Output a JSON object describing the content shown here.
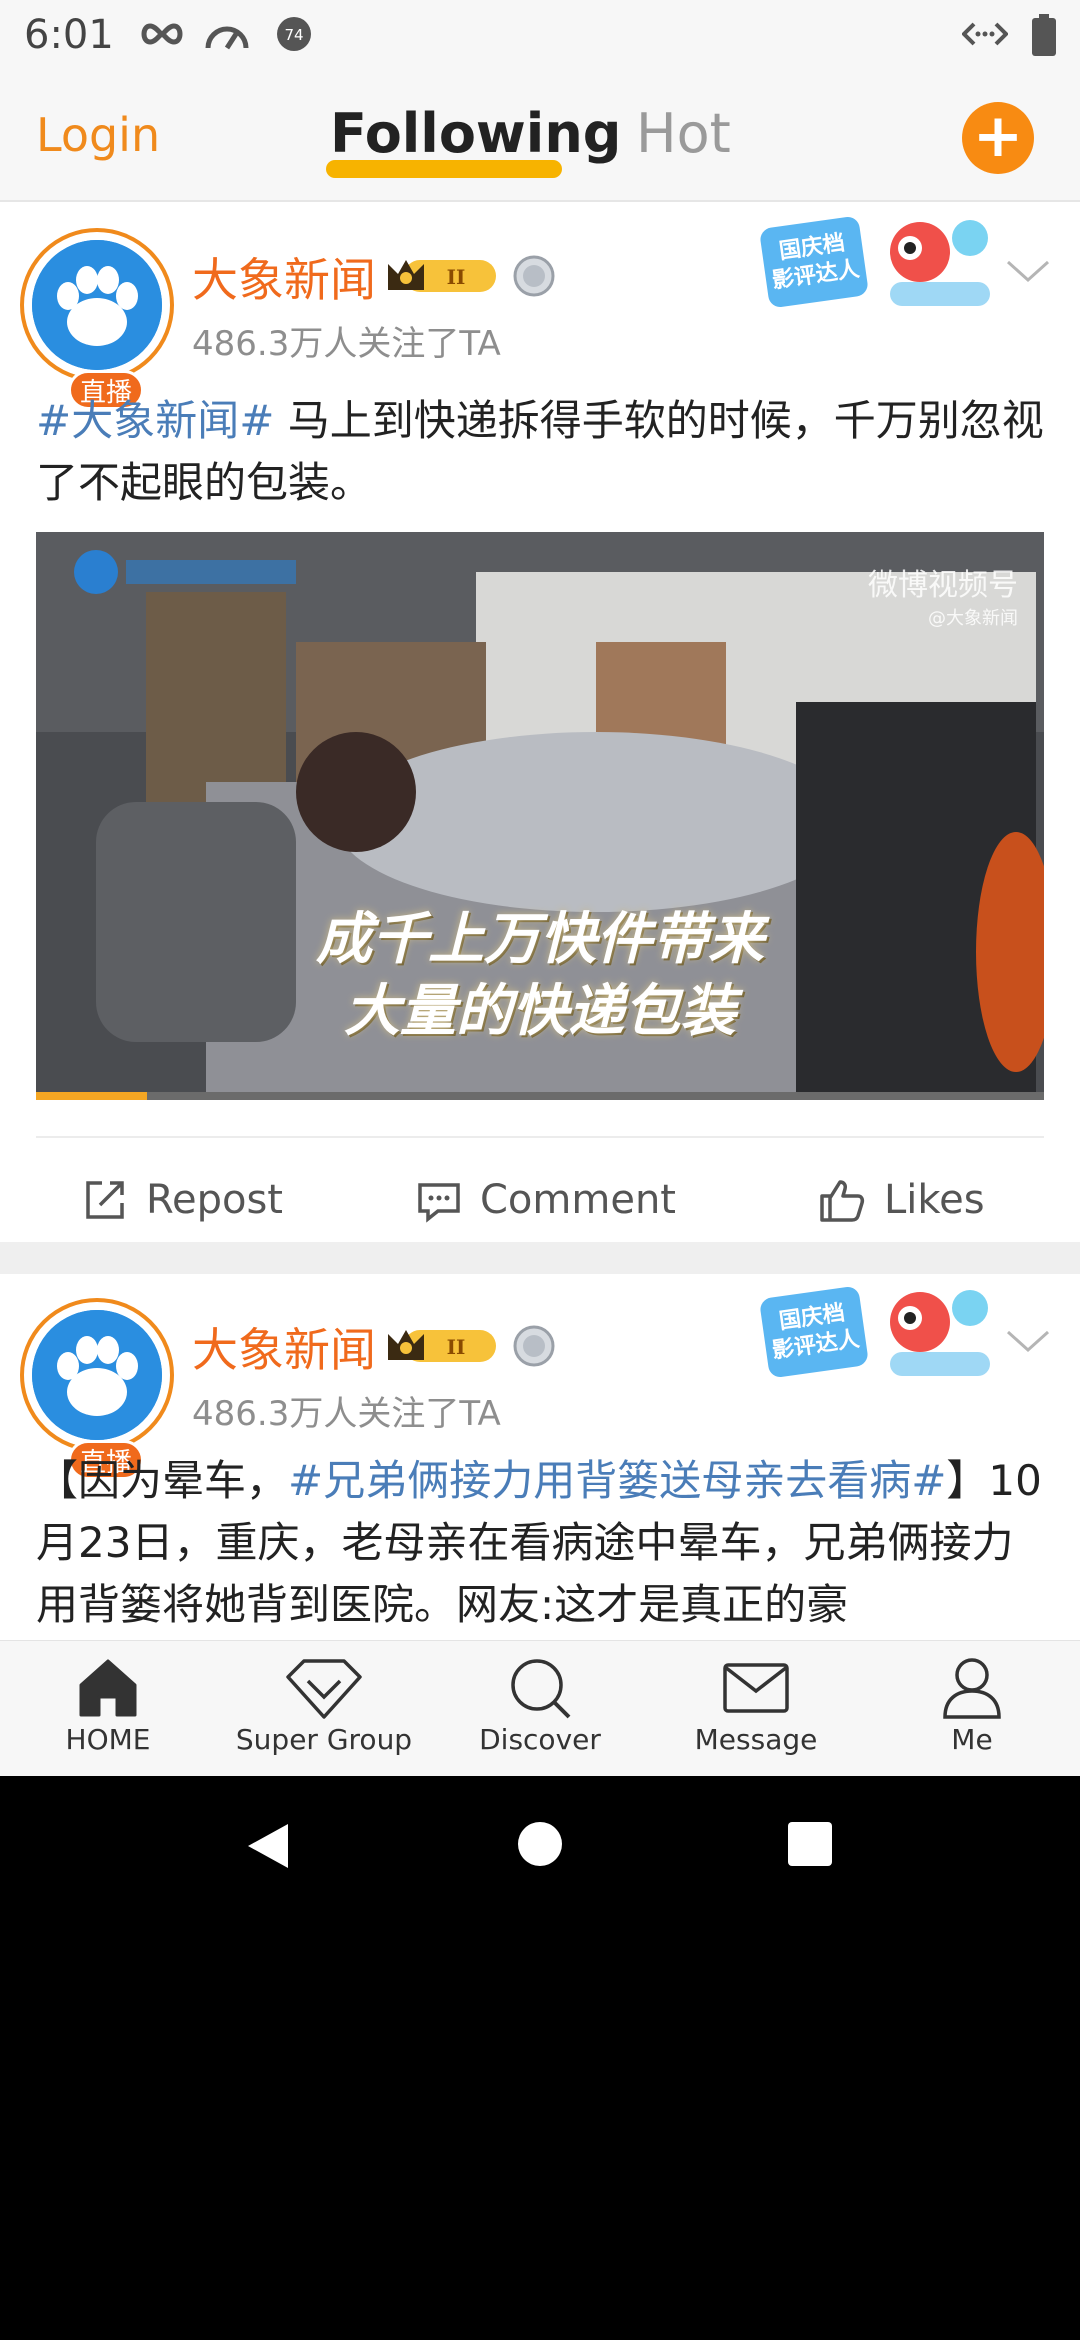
{
  "status_bar": {
    "time": "6:01",
    "notification_count": "74"
  },
  "top_nav": {
    "login": "Login",
    "tabs": [
      {
        "label": "Following",
        "active": true
      },
      {
        "label": "Hot",
        "active": false
      }
    ],
    "accent_color": "#f08a1c"
  },
  "posts": [
    {
      "username": "大象新闻",
      "live_badge": "直播",
      "vip_level": "II",
      "followers": "486.3万人关注了TA",
      "promo_text": "国庆档影评达人",
      "text_hashtag": "#大象新闻#",
      "text_body": " 马上到快递拆得手软的时候，千万别忽视了不起眼的包装。",
      "video": {
        "caption_line1": "成千上万快件带来",
        "caption_line2": "大量的快递包装",
        "watermark": "微博视频号",
        "watermark_sub": "@大象新闻",
        "progress": 0.11
      },
      "actions": {
        "repost": "Repost",
        "comment": "Comment",
        "likes": "Likes"
      }
    },
    {
      "username": "大象新闻",
      "live_badge": "直播",
      "vip_level": "II",
      "followers": "486.3万人关注了TA",
      "promo_text": "国庆档影评达人",
      "text_prefix": "【因为晕车，",
      "text_hashtag": "#兄弟俩接力用背篓送母亲去看病#",
      "text_body": "】10月23日，重庆，老母亲在看病途中晕车，兄弟俩接力用背篓将她背到医院。网友:这才是真正的豪"
    }
  ],
  "bottom_tabs": [
    {
      "label": "HOME",
      "icon": "home-icon"
    },
    {
      "label": "Super Group",
      "icon": "diamond-icon"
    },
    {
      "label": "Discover",
      "icon": "search-icon"
    },
    {
      "label": "Message",
      "icon": "mail-icon"
    },
    {
      "label": "Me",
      "icon": "person-icon"
    }
  ],
  "colors": {
    "hashtag": "#4a7db8",
    "username": "#f06a1c",
    "plus_button": "#f88b12",
    "tab_underline": "#f7b300"
  }
}
